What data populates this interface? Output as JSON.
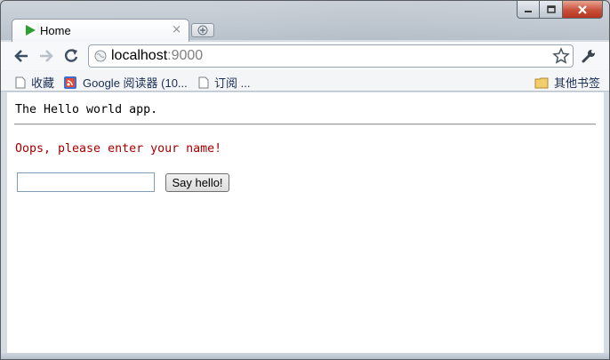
{
  "window": {
    "caption_buttons": [
      "minimize-icon",
      "maximize-icon",
      "close-icon"
    ]
  },
  "tab": {
    "title": "Home",
    "favicon": "play-icon",
    "close_glyph": "×",
    "new_tab_icon": "new-tab-icon"
  },
  "toolbar": {
    "back_icon": "back-arrow-icon",
    "forward_icon": "forward-arrow-icon",
    "reload_icon": "reload-icon",
    "url_host": "localhost",
    "url_port": ":9000",
    "star_icon": "star-icon",
    "wrench_icon": "wrench-icon"
  },
  "bookmarks": {
    "items": [
      {
        "label": "收藏",
        "icon": "page-icon"
      },
      {
        "label": "Google 阅读器 (10...",
        "icon": "google-reader-icon"
      },
      {
        "label": "订阅 ...",
        "icon": "page-icon"
      }
    ],
    "other_label": "其他书签",
    "other_icon": "folder-icon"
  },
  "page": {
    "heading": "The Hello world app.",
    "error": "Oops, please enter your name!",
    "input_value": "",
    "button_label": "Say hello!"
  },
  "colors": {
    "error_text": "#a40000",
    "favicon_green": "#2e9e32",
    "close_red": "#c8503a"
  }
}
